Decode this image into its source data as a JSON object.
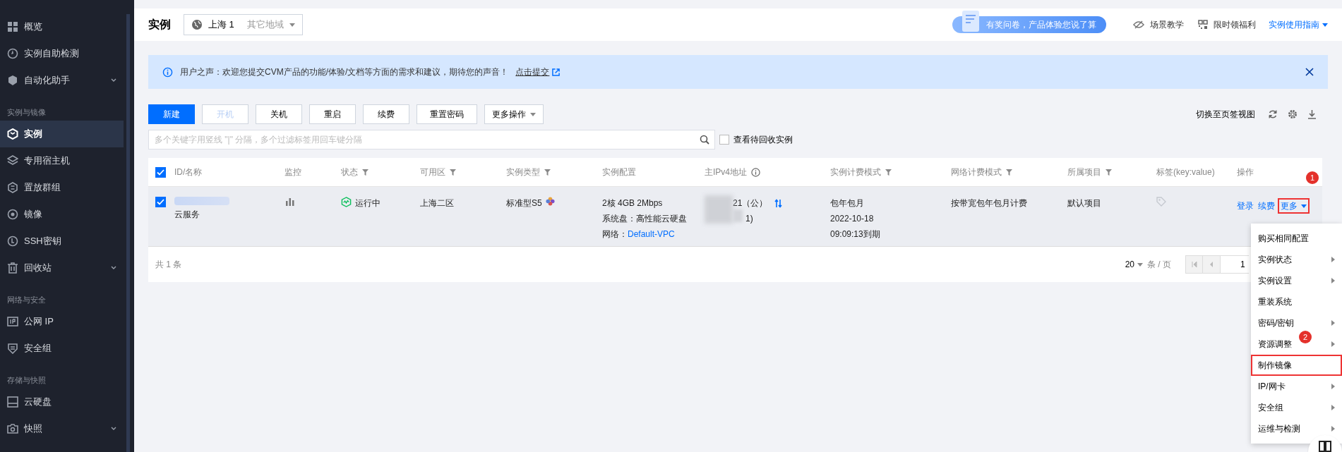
{
  "sidebar": {
    "items": [
      {
        "kind": "item",
        "label": "概览",
        "selected": false,
        "expandable": false
      },
      {
        "kind": "item",
        "label": "实例自助检测",
        "selected": false,
        "expandable": false
      },
      {
        "kind": "item",
        "label": "自动化助手",
        "selected": false,
        "expandable": true
      },
      {
        "kind": "section",
        "label": "实例与镜像"
      },
      {
        "kind": "item",
        "label": "实例",
        "selected": true,
        "expandable": false
      },
      {
        "kind": "item",
        "label": "专用宿主机",
        "selected": false,
        "expandable": false
      },
      {
        "kind": "item",
        "label": "置放群组",
        "selected": false,
        "expandable": false
      },
      {
        "kind": "item",
        "label": "镜像",
        "selected": false,
        "expandable": false
      },
      {
        "kind": "item",
        "label": "SSH密钥",
        "selected": false,
        "expandable": false
      },
      {
        "kind": "item",
        "label": "回收站",
        "selected": false,
        "expandable": true
      },
      {
        "kind": "section",
        "label": "网络与安全"
      },
      {
        "kind": "item",
        "label": "公网 IP",
        "selected": false,
        "expandable": false
      },
      {
        "kind": "item",
        "label": "安全组",
        "selected": false,
        "expandable": false
      },
      {
        "kind": "section",
        "label": "存储与快照"
      },
      {
        "kind": "item",
        "label": "云硬盘",
        "selected": false,
        "expandable": false
      },
      {
        "kind": "item",
        "label": "快照",
        "selected": false,
        "expandable": true
      }
    ]
  },
  "header": {
    "title": "实例",
    "region": "上海 1",
    "other_region": "其它地域",
    "survey": "有奖问卷，产品体验您说了算",
    "links": [
      "场景教学",
      "限时领福利"
    ],
    "guide": "实例使用指南"
  },
  "notice": {
    "text": "用户之声：欢迎您提交CVM产品的功能/体验/文档等方面的需求和建议，期待您的声音！",
    "link": "点击提交"
  },
  "toolbar": {
    "buttons": [
      {
        "label": "新建",
        "kind": "primary",
        "disabled": false
      },
      {
        "label": "开机",
        "kind": "default",
        "disabled": true
      },
      {
        "label": "关机",
        "kind": "default",
        "disabled": false
      },
      {
        "label": "重启",
        "kind": "default",
        "disabled": false
      },
      {
        "label": "续费",
        "kind": "default",
        "disabled": false
      },
      {
        "label": "重置密码",
        "kind": "default",
        "disabled": false
      },
      {
        "label": "更多操作",
        "kind": "dropdown",
        "disabled": false
      }
    ],
    "view_switch": "切换至页签视图"
  },
  "search": {
    "placeholder": "多个关键字用竖线 \"|\" 分隔，多个过滤标签用回车键分隔",
    "recycle_label": "查看待回收实例",
    "recycle_checked": false
  },
  "table": {
    "all_checked": true,
    "columns": [
      {
        "label": "ID/名称",
        "filter": false,
        "info": false
      },
      {
        "label": "监控",
        "filter": false,
        "info": false
      },
      {
        "label": "状态",
        "filter": true,
        "info": false
      },
      {
        "label": "可用区",
        "filter": true,
        "info": false
      },
      {
        "label": "实例类型",
        "filter": true,
        "info": false
      },
      {
        "label": "实例配置",
        "filter": false,
        "info": false
      },
      {
        "label": "主IPv4地址",
        "filter": false,
        "info": true
      },
      {
        "label": "实例计费模式",
        "filter": true,
        "info": false
      },
      {
        "label": "网络计费模式",
        "filter": true,
        "info": false
      },
      {
        "label": "所属项目",
        "filter": true,
        "info": false
      },
      {
        "label": "标签(key:value)",
        "filter": false,
        "info": false
      },
      {
        "label": "操作",
        "filter": false,
        "info": false
      }
    ],
    "rows": [
      {
        "checked": true,
        "name": "云服务",
        "status": "运行中",
        "zone": "上海二区",
        "type": "标准型S5",
        "config": [
          "2核 4GB 2Mbps",
          "系统盘：高性能云硬盘"
        ],
        "network_label": "网络：",
        "network": "Default-VPC",
        "ip_public": "21（公）",
        "ip_private": "1)",
        "billing": [
          "包年包月",
          "2022-10-18",
          "09:09:13到期"
        ],
        "net_billing": "按带宽包年包月计费",
        "project": "默认项目",
        "actions": [
          "登录",
          "续费"
        ],
        "more": "更多",
        "more_outlined": true,
        "more_marker": "1"
      }
    ],
    "total": "共 1 条",
    "page_size": "20",
    "per_page": "条 / 页",
    "page": "1"
  },
  "menu": {
    "items": [
      {
        "label": "购买相同配置",
        "submenu": false,
        "outlined": false
      },
      {
        "label": "实例状态",
        "submenu": true,
        "outlined": false
      },
      {
        "label": "实例设置",
        "submenu": true,
        "outlined": false
      },
      {
        "label": "重装系统",
        "submenu": false,
        "outlined": false
      },
      {
        "label": "密码/密钥",
        "submenu": true,
        "outlined": false
      },
      {
        "label": "资源调整",
        "submenu": true,
        "outlined": false,
        "marker": "2"
      },
      {
        "label": "制作镜像",
        "submenu": false,
        "outlined": true
      },
      {
        "label": "IP/网卡",
        "submenu": true,
        "outlined": false
      },
      {
        "label": "安全组",
        "submenu": true,
        "outlined": false
      },
      {
        "label": "运维与检测",
        "submenu": true,
        "outlined": false
      }
    ]
  }
}
